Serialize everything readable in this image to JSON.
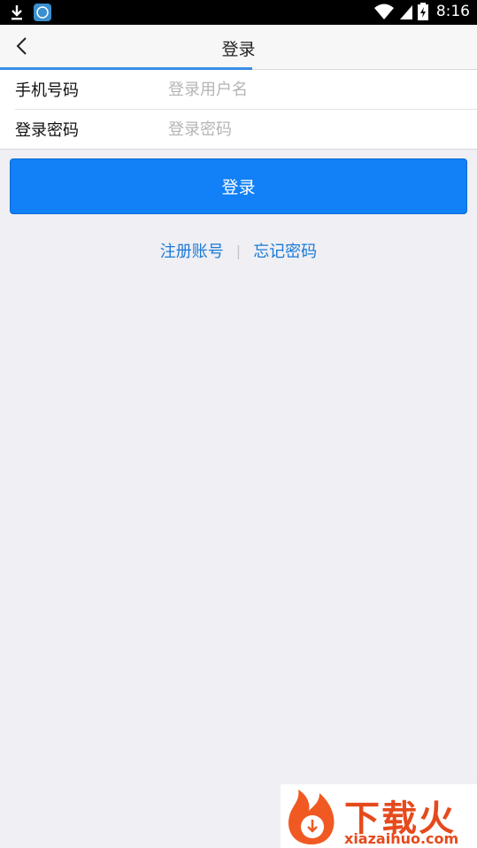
{
  "status_bar": {
    "time": "8:16",
    "icons": [
      "download-icon",
      "app-icon",
      "wifi-icon",
      "signal-icon",
      "battery-icon"
    ]
  },
  "header": {
    "title": "登录",
    "back_icon": "chevron-left-icon"
  },
  "form": {
    "phone": {
      "label": "手机号码",
      "placeholder": "登录用户名",
      "value": ""
    },
    "password": {
      "label": "登录密码",
      "placeholder": "登录密码",
      "value": ""
    }
  },
  "login_button": {
    "label": "登录"
  },
  "links": {
    "register": "注册账号",
    "divider": "|",
    "forgot": "忘记密码"
  },
  "watermark": {
    "logo_text": "下载火",
    "site_text": "xiazaihuo.com"
  },
  "colors": {
    "accent": "#1280f6",
    "link": "#1a7ad6",
    "background": "#efeff4",
    "watermark": "#e64a1c"
  }
}
